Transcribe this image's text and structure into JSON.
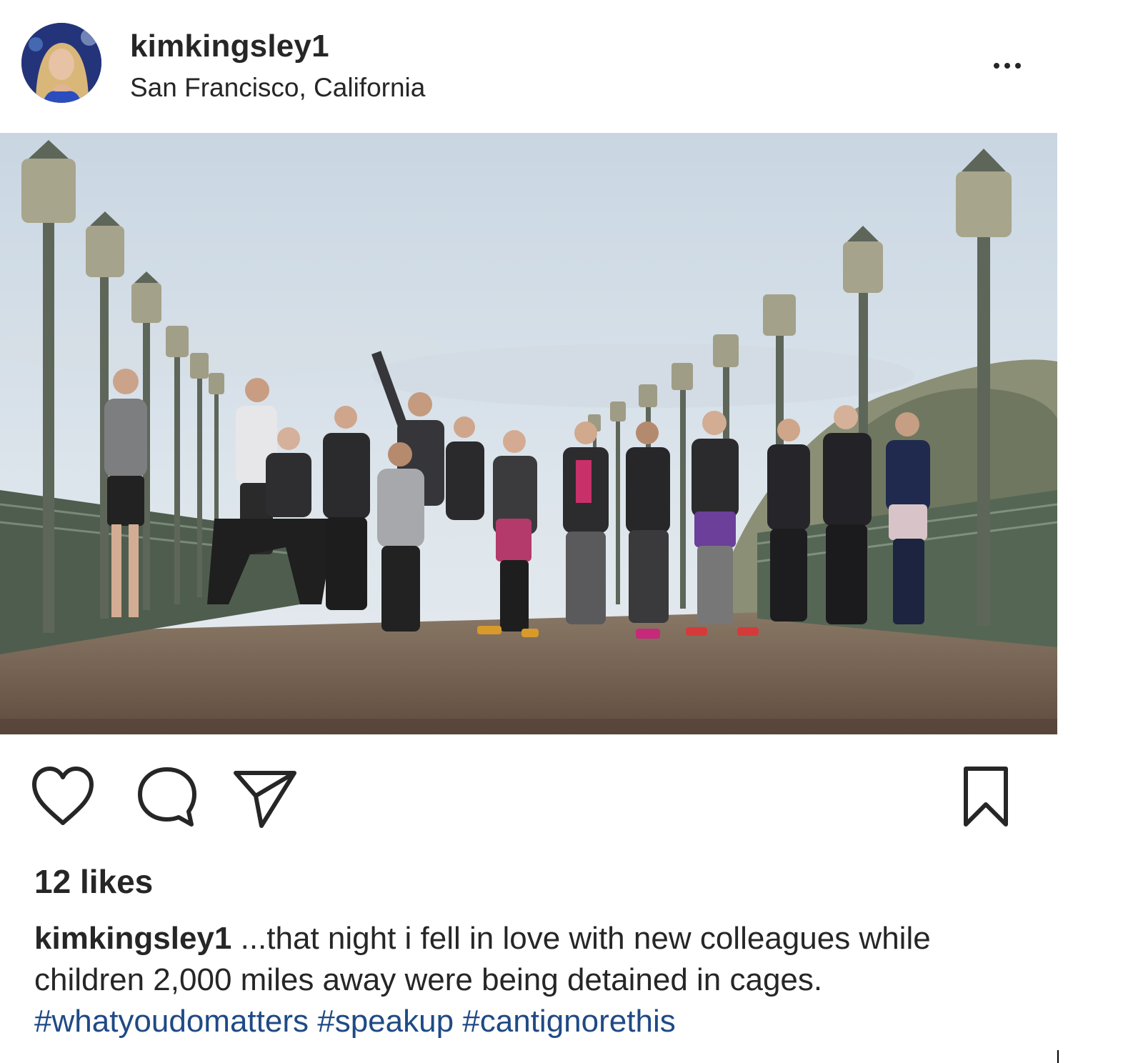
{
  "post": {
    "username": "kimkingsley1",
    "location": "San Francisco, California",
    "more_icon": "more-horizontal-icon",
    "photo_description_alt": "",
    "likes_text": "12 likes",
    "caption": {
      "username": "kimkingsley1",
      "text_part1": " ...that night i fell in love with new colleagues while children 2,000 miles away were being detained in cages. ",
      "hashtags": [
        "#whatyoudomatters",
        "#speakup",
        "#cantignorethis"
      ]
    }
  },
  "actions": {
    "like_icon": "heart-icon",
    "comment_icon": "comment-icon",
    "share_icon": "share-icon",
    "save_icon": "bookmark-icon"
  },
  "colors": {
    "text": "#262626",
    "hashtag": "#1f4a85",
    "background": "#ffffff"
  }
}
